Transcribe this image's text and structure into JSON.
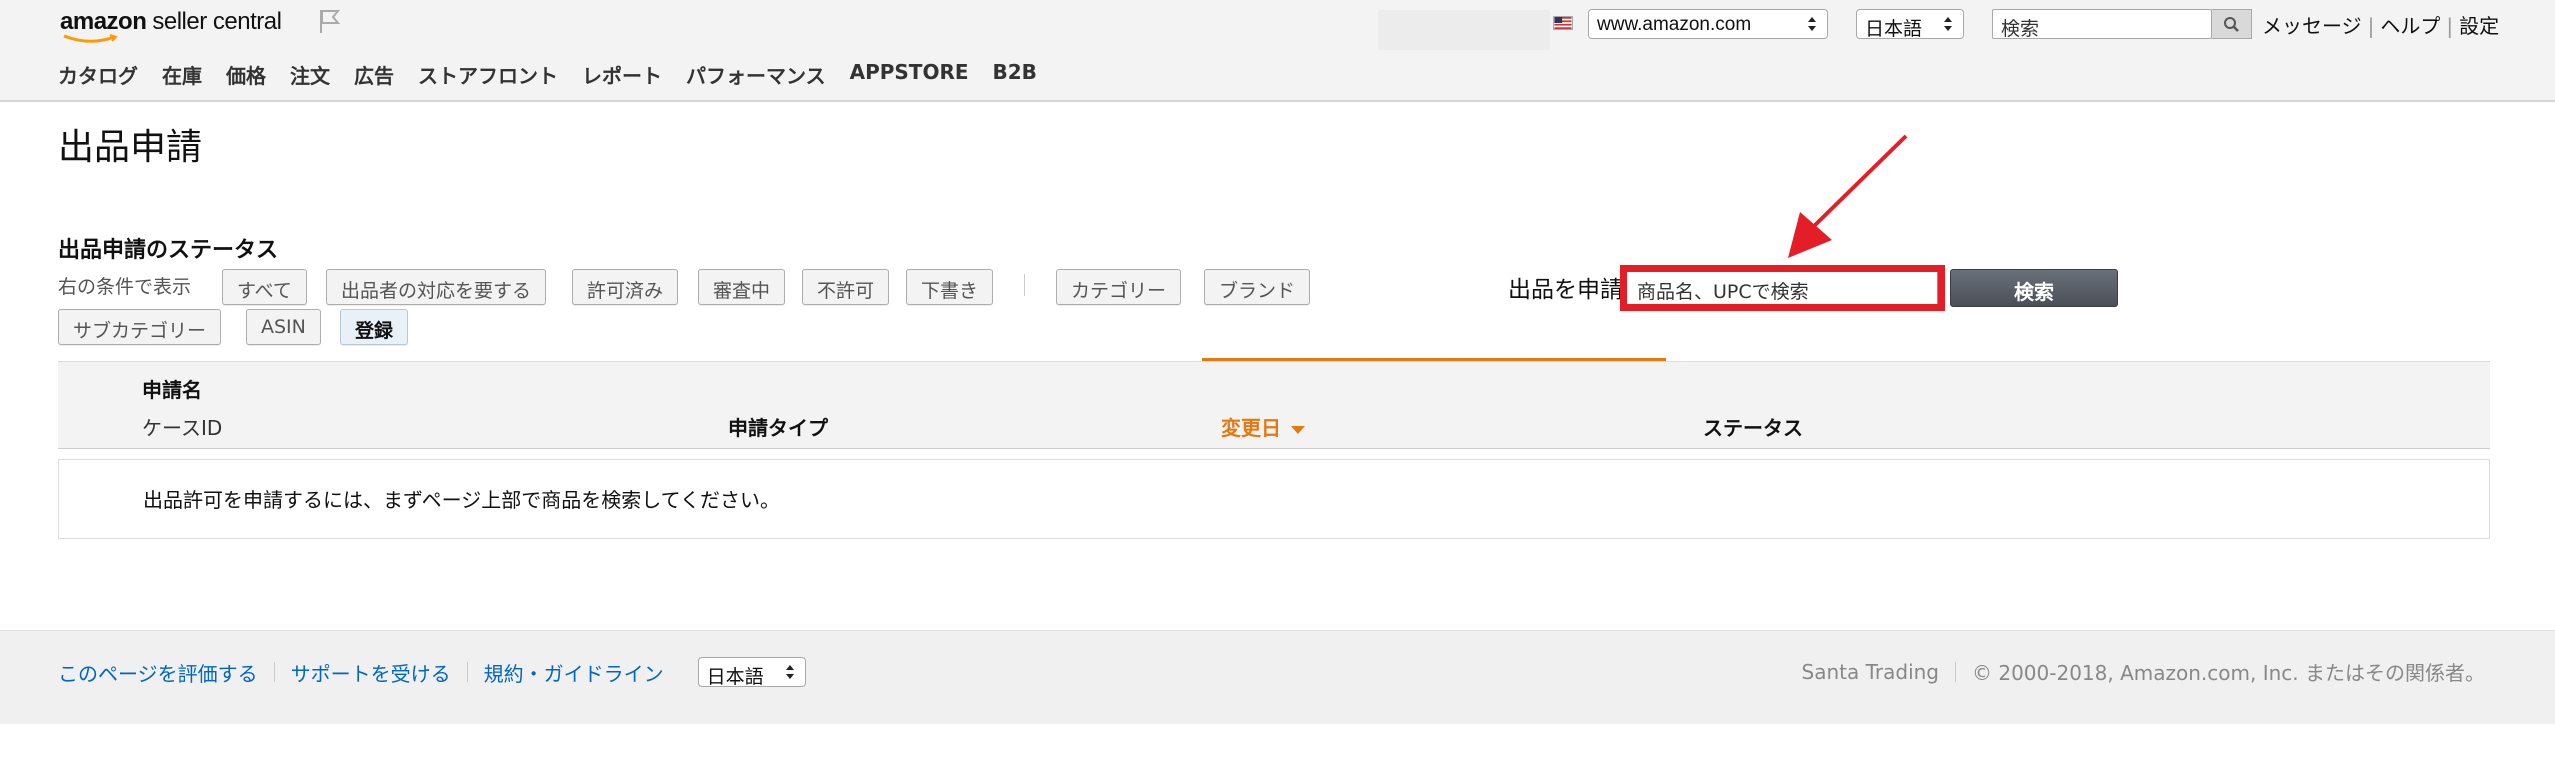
{
  "header": {
    "logo_amazon": "amazon",
    "logo_sc": "seller central",
    "marketplace": "www.amazon.com",
    "language": "日本語",
    "search_placeholder": "検索",
    "links": [
      "メッセージ",
      "ヘルプ",
      "設定"
    ]
  },
  "nav": [
    "カタログ",
    "在庫",
    "価格",
    "注文",
    "広告",
    "ストアフロント",
    "レポート",
    "パフォーマンス",
    "APPSTORE",
    "B2B"
  ],
  "page": {
    "title": "出品申請",
    "status_title": "出品申請のステータス",
    "filter_label": "右の条件で表示",
    "filters": [
      "すべて",
      "出品者の対応を要する",
      "許可済み",
      "審査中",
      "不許可",
      "下書き"
    ],
    "filters2": [
      "カテゴリー",
      "ブランド",
      "サブカテゴリー",
      "ASIN",
      "登録"
    ],
    "apply_label": "出品を申請",
    "apply_input": "商品名、UPCで検索",
    "apply_button": "検索"
  },
  "table": {
    "col_name": "申請名",
    "col_case": "ケースID",
    "col_type": "申請タイプ",
    "col_date": "変更日",
    "col_status": "ステータス",
    "empty_message": "出品許可を申請するには、まずページ上部で商品を検索してください。"
  },
  "footer": {
    "links": [
      "このページを評価する",
      "サポートを受ける",
      "規約・ガイドライン"
    ],
    "language": "日本語",
    "store": "Santa Trading",
    "copyright": "© 2000-2018, Amazon.com, Inc. またはその関係者。"
  },
  "colors": {
    "accent_orange": "#e47911",
    "link_blue": "#0066c0",
    "highlight_red": "#e41e26"
  }
}
